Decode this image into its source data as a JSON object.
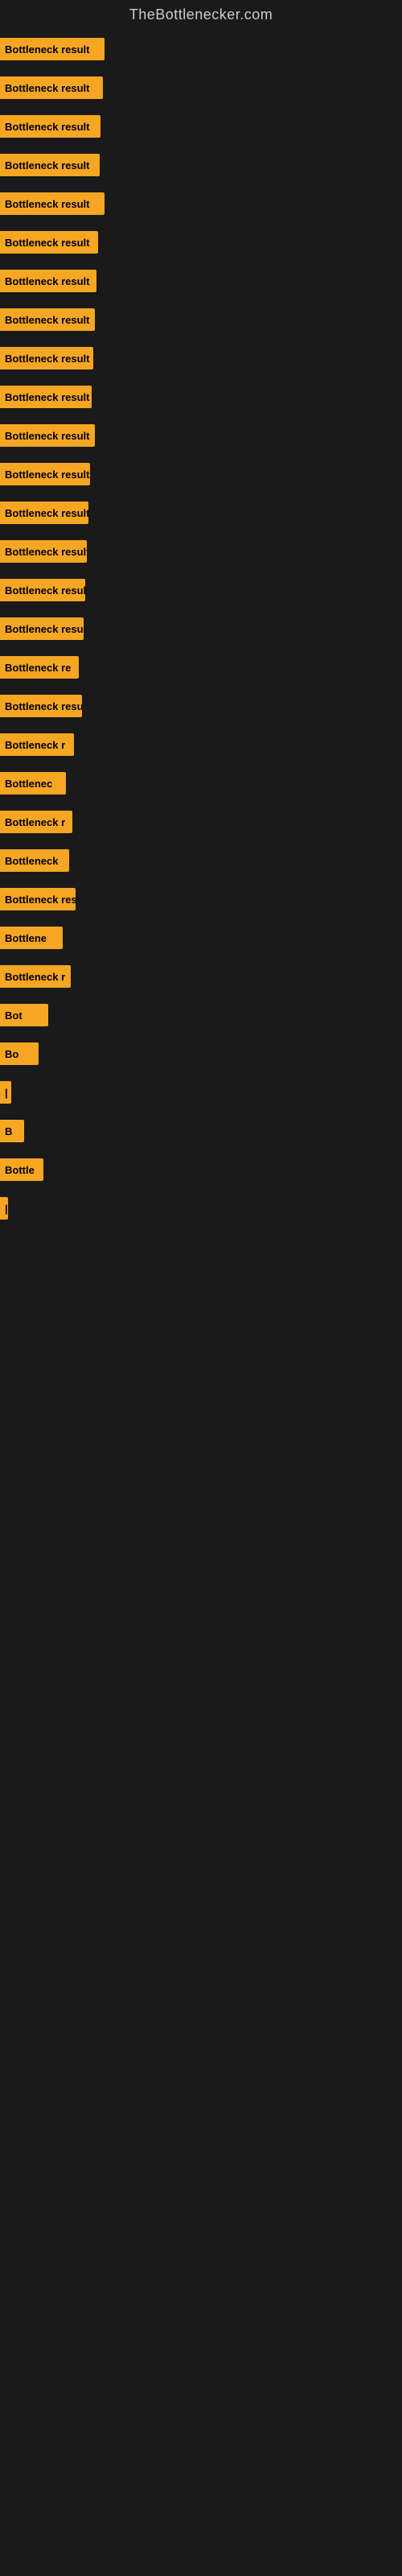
{
  "site": {
    "title": "TheBottlenecker.com"
  },
  "bars": [
    {
      "label": "Bottleneck result",
      "width": 130
    },
    {
      "label": "Bottleneck result",
      "width": 128
    },
    {
      "label": "Bottleneck result",
      "width": 125
    },
    {
      "label": "Bottleneck result",
      "width": 124
    },
    {
      "label": "Bottleneck result",
      "width": 130
    },
    {
      "label": "Bottleneck result",
      "width": 122
    },
    {
      "label": "Bottleneck result",
      "width": 120
    },
    {
      "label": "Bottleneck result",
      "width": 118
    },
    {
      "label": "Bottleneck result",
      "width": 116
    },
    {
      "label": "Bottleneck result",
      "width": 114
    },
    {
      "label": "Bottleneck result",
      "width": 118
    },
    {
      "label": "Bottleneck result",
      "width": 112
    },
    {
      "label": "Bottleneck result",
      "width": 110
    },
    {
      "label": "Bottleneck result",
      "width": 108
    },
    {
      "label": "Bottleneck result",
      "width": 106
    },
    {
      "label": "Bottleneck result",
      "width": 104
    },
    {
      "label": "Bottleneck re",
      "width": 98
    },
    {
      "label": "Bottleneck result",
      "width": 102
    },
    {
      "label": "Bottleneck r",
      "width": 92
    },
    {
      "label": "Bottlenec",
      "width": 82
    },
    {
      "label": "Bottleneck r",
      "width": 90
    },
    {
      "label": "Bottleneck",
      "width": 86
    },
    {
      "label": "Bottleneck res",
      "width": 94
    },
    {
      "label": "Bottlene",
      "width": 78
    },
    {
      "label": "Bottleneck r",
      "width": 88
    },
    {
      "label": "Bot",
      "width": 60
    },
    {
      "label": "Bo",
      "width": 48
    },
    {
      "label": "|",
      "width": 14
    },
    {
      "label": "B",
      "width": 30
    },
    {
      "label": "Bottle",
      "width": 54
    },
    {
      "label": "|",
      "width": 10
    }
  ]
}
